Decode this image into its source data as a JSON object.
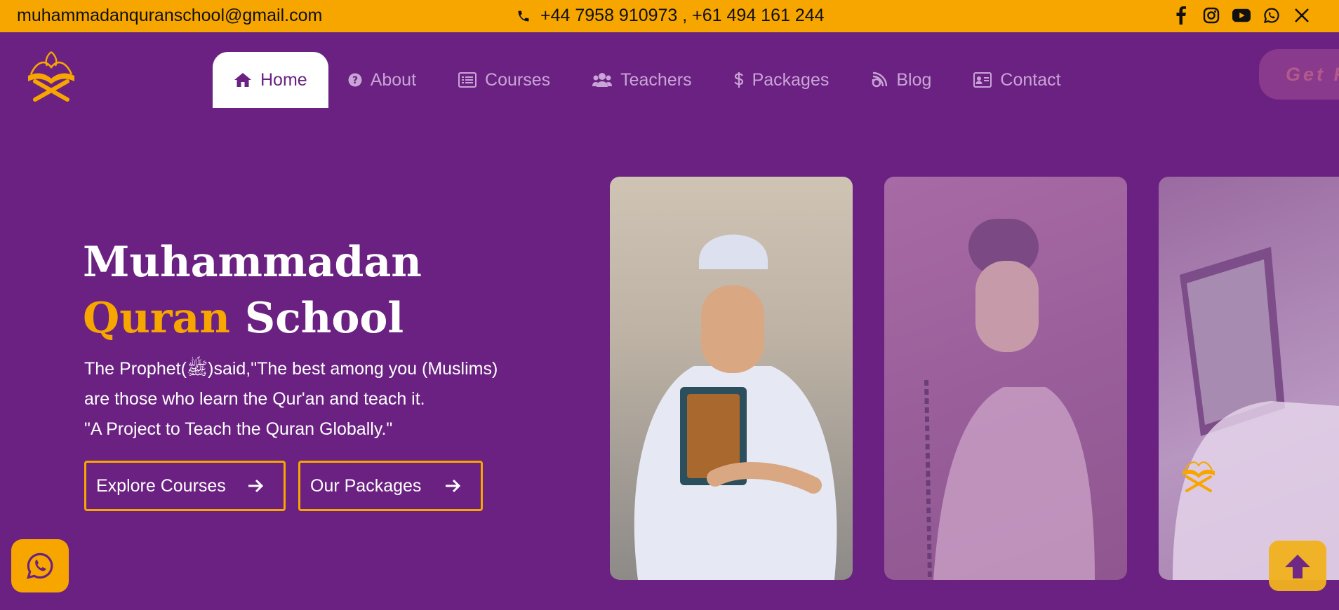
{
  "topbar": {
    "email": "muhammadanquranschool@gmail.com",
    "phone": "+44 7958 910973 , +61 494 161 244",
    "social_icons": [
      "facebook-icon",
      "instagram-icon",
      "youtube-icon",
      "whatsapp-icon",
      "x-icon"
    ]
  },
  "nav": {
    "items": [
      {
        "label": "Home",
        "icon": "home-icon",
        "active": true
      },
      {
        "label": "About",
        "icon": "question-circle-icon"
      },
      {
        "label": "Courses",
        "icon": "list-icon"
      },
      {
        "label": "Teachers",
        "icon": "users-icon"
      },
      {
        "label": "Packages",
        "icon": "dollar-icon"
      },
      {
        "label": "Blog",
        "icon": "blog-icon"
      },
      {
        "label": "Contact",
        "icon": "address-card-icon"
      }
    ],
    "cta_label": "Get F"
  },
  "hero": {
    "title_line1": "Muhammadan",
    "title_accent": "Quran",
    "title_rest": " School",
    "text_line1": "The Prophet(ﷺ)said,\"The best among you (Muslims)",
    "text_line2": "are those who learn the Qur'an and teach it.",
    "text_line3": "\"A Project to Teach the Quran Globally.\"",
    "btn_courses": "Explore Courses",
    "btn_packages": "Our Packages"
  },
  "colors": {
    "brand_purple": "#6a2181",
    "accent_orange": "#f7a600"
  }
}
